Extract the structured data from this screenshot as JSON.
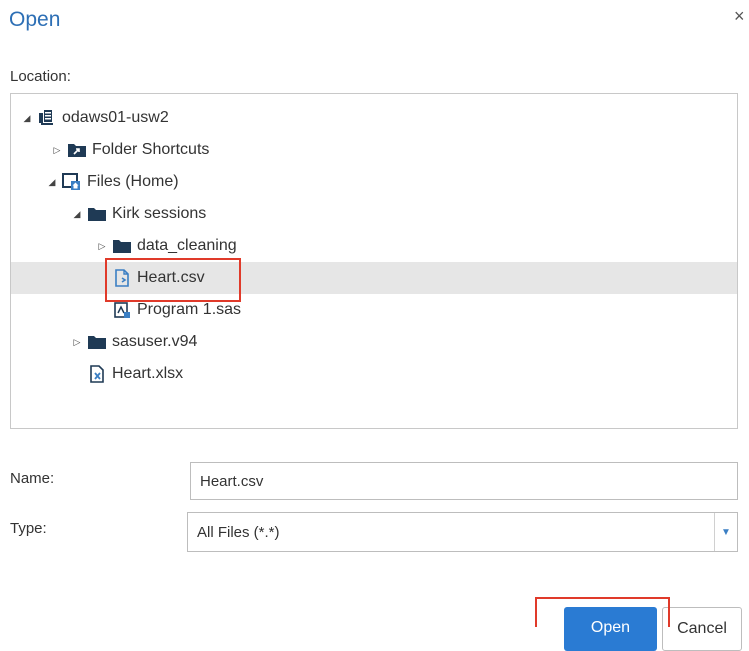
{
  "dialog": {
    "title": "Open",
    "close_glyph": "×"
  },
  "location": {
    "label": "Location:",
    "tree": [
      {
        "label": "odaws01-usw2",
        "icon": "server-icon",
        "toggle": "expanded"
      },
      {
        "label": "Folder Shortcuts",
        "icon": "folder-shortcut-icon",
        "toggle": "collapsed"
      },
      {
        "label": "Files (Home)",
        "icon": "home-folder-icon",
        "toggle": "expanded"
      },
      {
        "label": "Kirk sessions",
        "icon": "folder-icon",
        "toggle": "expanded"
      },
      {
        "label": "data_cleaning",
        "icon": "folder-icon",
        "toggle": "collapsed"
      },
      {
        "label": "Heart.csv",
        "icon": "csv-file-icon",
        "toggle": "none",
        "selected": true
      },
      {
        "label": "Program 1.sas",
        "icon": "sas-program-icon",
        "toggle": "none"
      },
      {
        "label": "sasuser.v94",
        "icon": "folder-icon",
        "toggle": "collapsed"
      },
      {
        "label": "Heart.xlsx",
        "icon": "excel-file-icon",
        "toggle": "none"
      }
    ]
  },
  "name_field": {
    "label": "Name:",
    "value": "Heart.csv"
  },
  "type_field": {
    "label": "Type:",
    "value": "All Files (*.*)"
  },
  "buttons": {
    "open": "Open",
    "cancel": "Cancel"
  },
  "colors": {
    "accent": "#2a7bd3",
    "title": "#2d6fb5",
    "highlight": "#e03a2a",
    "folder": "#1f3a55",
    "selected_row": "#e6e6e6"
  }
}
